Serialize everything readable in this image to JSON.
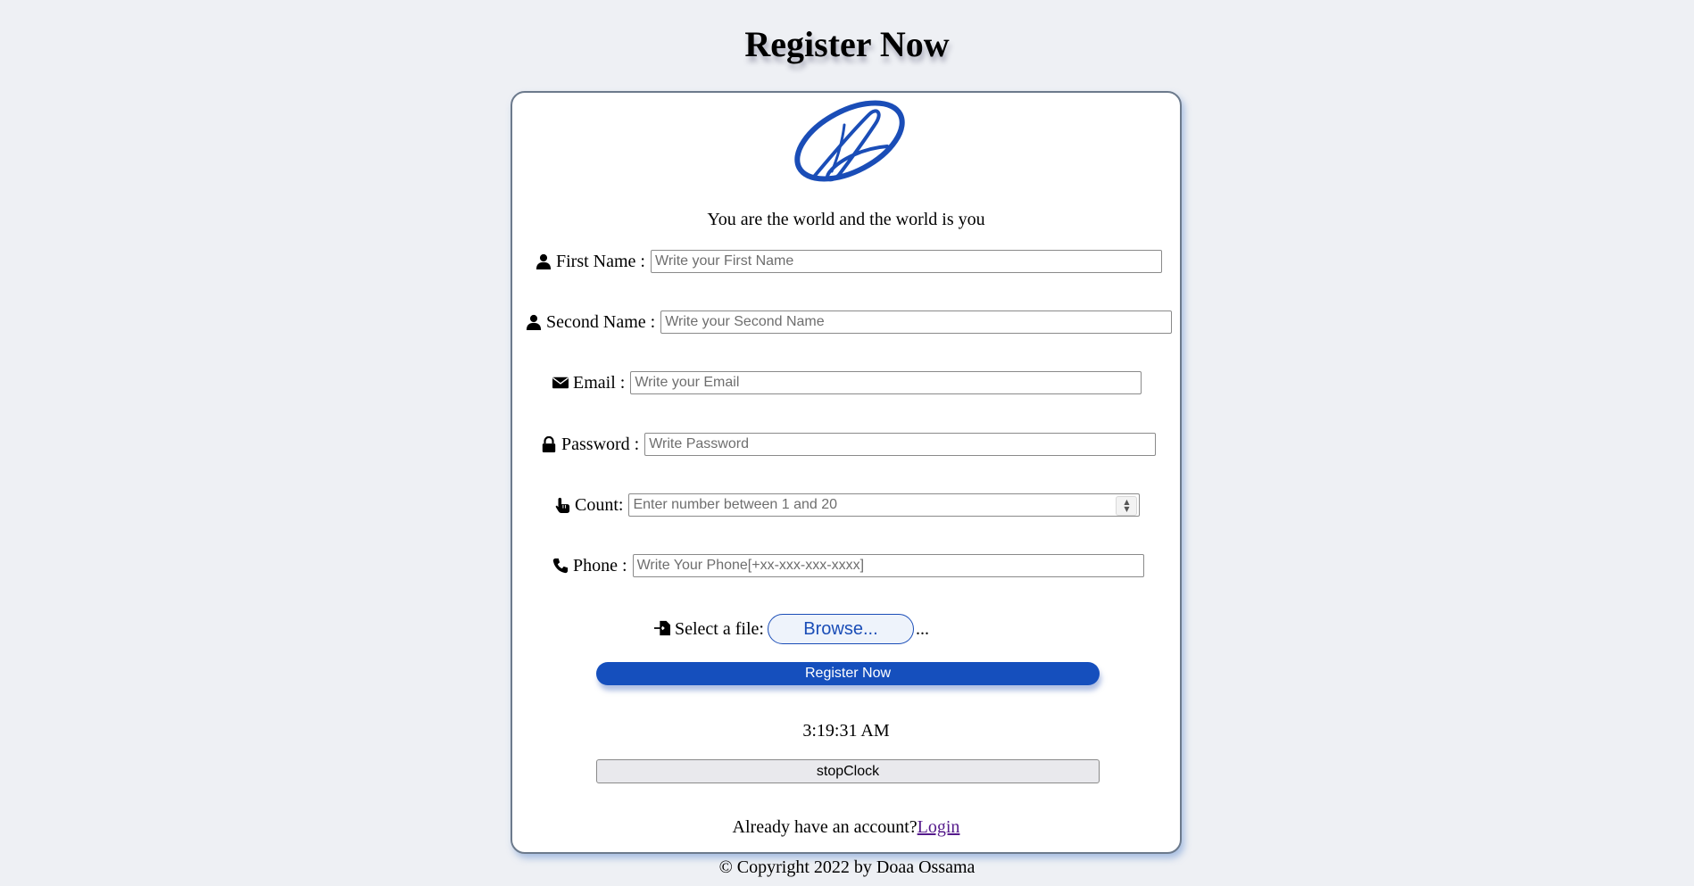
{
  "page": {
    "title": "Register Now",
    "motto": "You are the world and the world is you"
  },
  "form": {
    "first_name": {
      "label": "First Name :",
      "placeholder": "Write your First Name",
      "icon": "user-icon"
    },
    "second_name": {
      "label": "Second Name :",
      "placeholder": "Write your Second Name",
      "icon": "user-icon"
    },
    "email": {
      "label": "Email :",
      "placeholder": "Write your Email",
      "icon": "envelope-icon"
    },
    "password": {
      "label": "Password :",
      "placeholder": "Write Password",
      "icon": "lock-icon"
    },
    "count": {
      "label": "Count:",
      "placeholder": "Enter number between 1 and 20",
      "icon": "pointer-hand-icon"
    },
    "phone": {
      "label": "Phone :",
      "placeholder": "Write Your Phone[+xx-xxx-xxx-xxxx]",
      "icon": "phone-icon"
    },
    "file": {
      "label": "Select a file:",
      "button_label": "Browse...",
      "selected": "...",
      "icon": "file-import-icon"
    },
    "submit_label": "Register Now"
  },
  "clock": {
    "time": "3:19:31 AM",
    "stop_label": "stopClock"
  },
  "footer": {
    "account_text": "Already have an account?",
    "login_label": "Login",
    "copyright": "© Copyright 2022 by Doaa Ossama"
  },
  "colors": {
    "accent": "#154fbd",
    "background": "#eef0f4",
    "link": "#551a8b"
  }
}
